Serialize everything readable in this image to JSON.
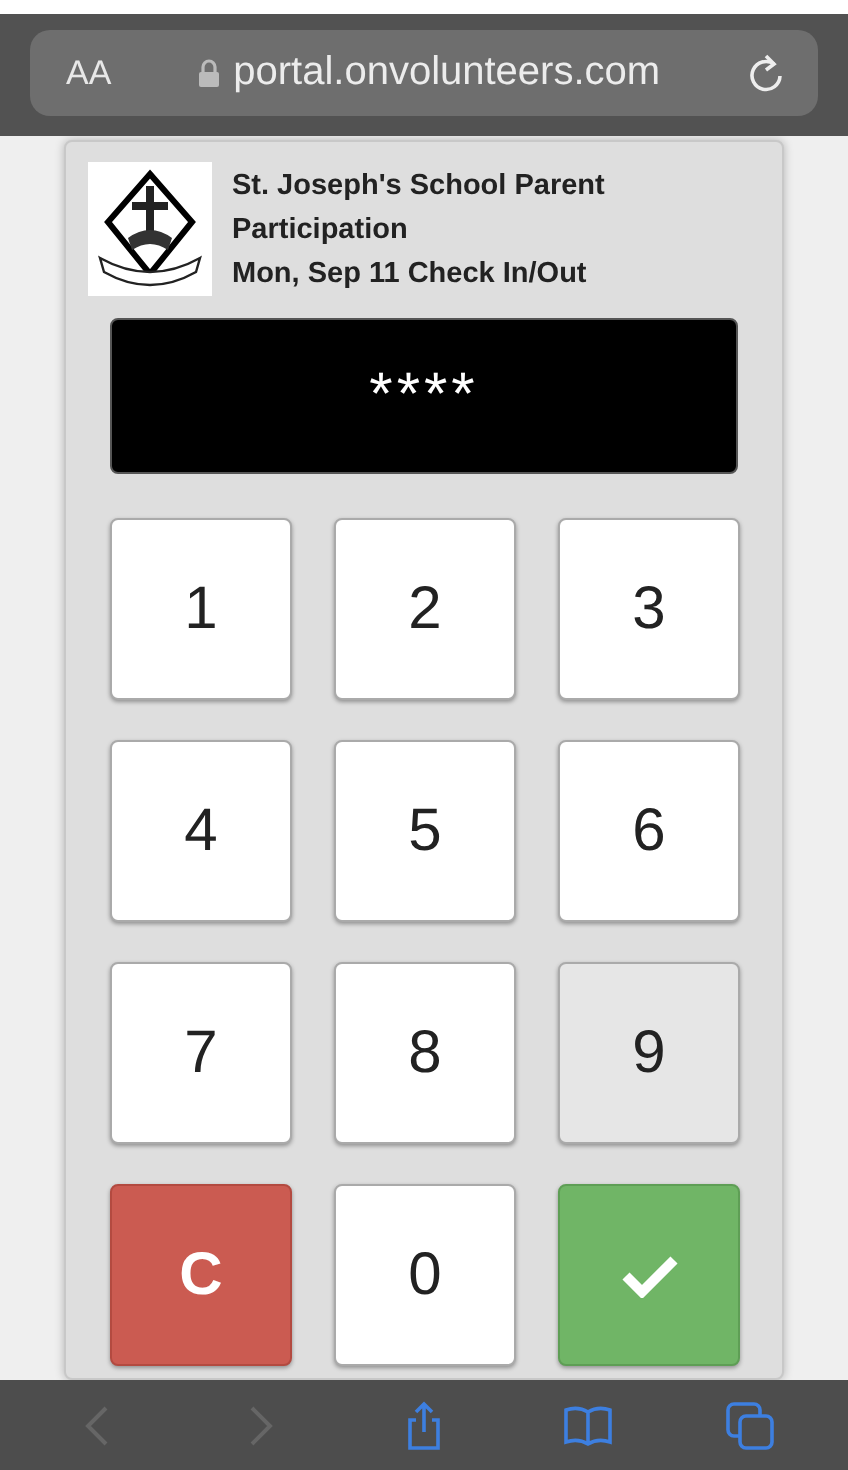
{
  "browser": {
    "text_size_button": "AA",
    "url": "portal.onvolunteers.com"
  },
  "header": {
    "title": "St. Joseph's School Parent Participation",
    "subtitle": "Mon, Sep 11 Check In/Out"
  },
  "display": {
    "value": "****"
  },
  "keys": [
    {
      "kind": "digit",
      "label": "1",
      "pressed": false
    },
    {
      "kind": "digit",
      "label": "2",
      "pressed": false
    },
    {
      "kind": "digit",
      "label": "3",
      "pressed": false
    },
    {
      "kind": "digit",
      "label": "4",
      "pressed": false
    },
    {
      "kind": "digit",
      "label": "5",
      "pressed": false
    },
    {
      "kind": "digit",
      "label": "6",
      "pressed": false
    },
    {
      "kind": "digit",
      "label": "7",
      "pressed": false
    },
    {
      "kind": "digit",
      "label": "8",
      "pressed": false
    },
    {
      "kind": "digit",
      "label": "9",
      "pressed": true
    },
    {
      "kind": "clear",
      "label": "C",
      "pressed": false
    },
    {
      "kind": "digit",
      "label": "0",
      "pressed": false
    },
    {
      "kind": "submit",
      "pressed": false
    }
  ],
  "toolbar": [
    {
      "kind": "back",
      "disabled": true
    },
    {
      "kind": "forward",
      "disabled": true
    },
    {
      "kind": "share",
      "disabled": false
    },
    {
      "kind": "bookmarks",
      "disabled": false
    },
    {
      "kind": "tabs",
      "disabled": false
    }
  ]
}
